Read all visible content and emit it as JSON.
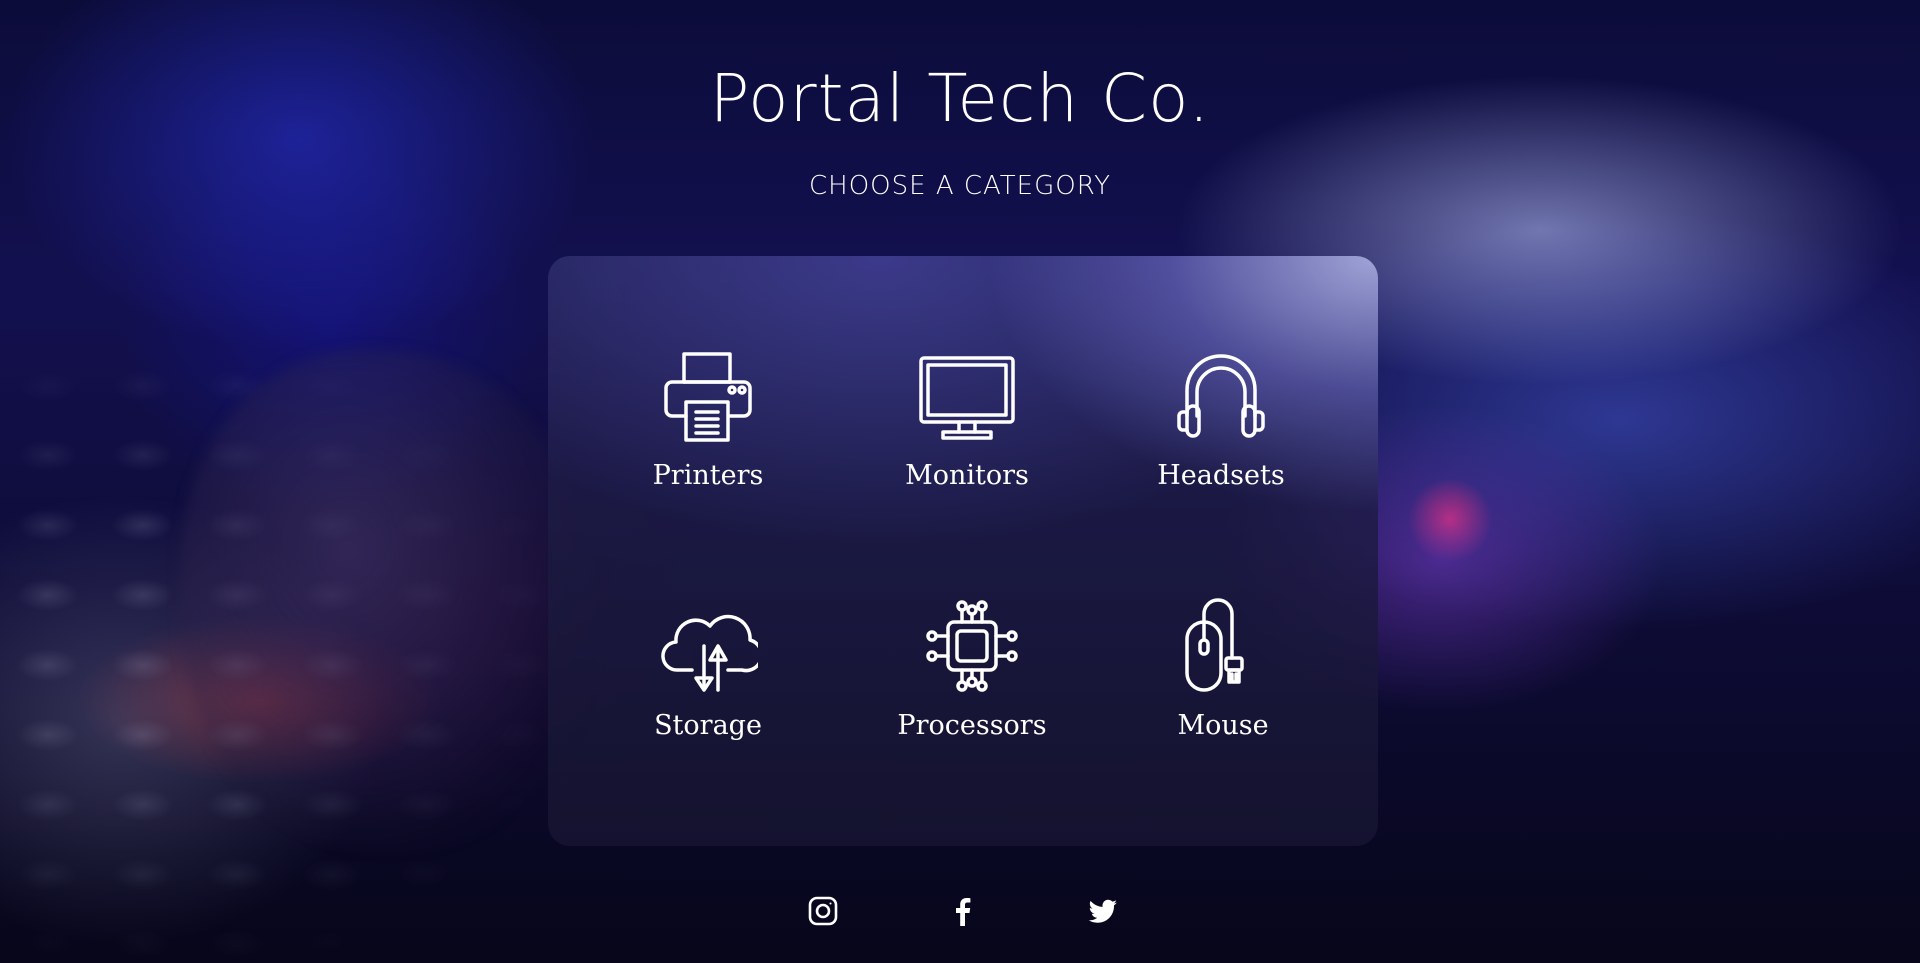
{
  "brand": {
    "title": "Portal Tech Co.",
    "subtitle": "CHOOSE A CATEGORY"
  },
  "categories": [
    {
      "label": "Printers",
      "icon": "printer-icon"
    },
    {
      "label": "Monitors",
      "icon": "monitor-icon"
    },
    {
      "label": "Headsets",
      "icon": "headset-icon"
    },
    {
      "label": "Storage",
      "icon": "cloud-storage-icon"
    },
    {
      "label": "Processors",
      "icon": "processor-chip-icon"
    },
    {
      "label": "Mouse",
      "icon": "mouse-icon"
    }
  ],
  "social": [
    {
      "name": "instagram",
      "icon": "instagram-icon"
    },
    {
      "name": "facebook",
      "icon": "facebook-icon"
    },
    {
      "name": "twitter",
      "icon": "twitter-icon"
    }
  ],
  "colors": {
    "text": "#ffffff",
    "panel_accent": "#aeb3e6",
    "background": "#0b0b2a"
  }
}
